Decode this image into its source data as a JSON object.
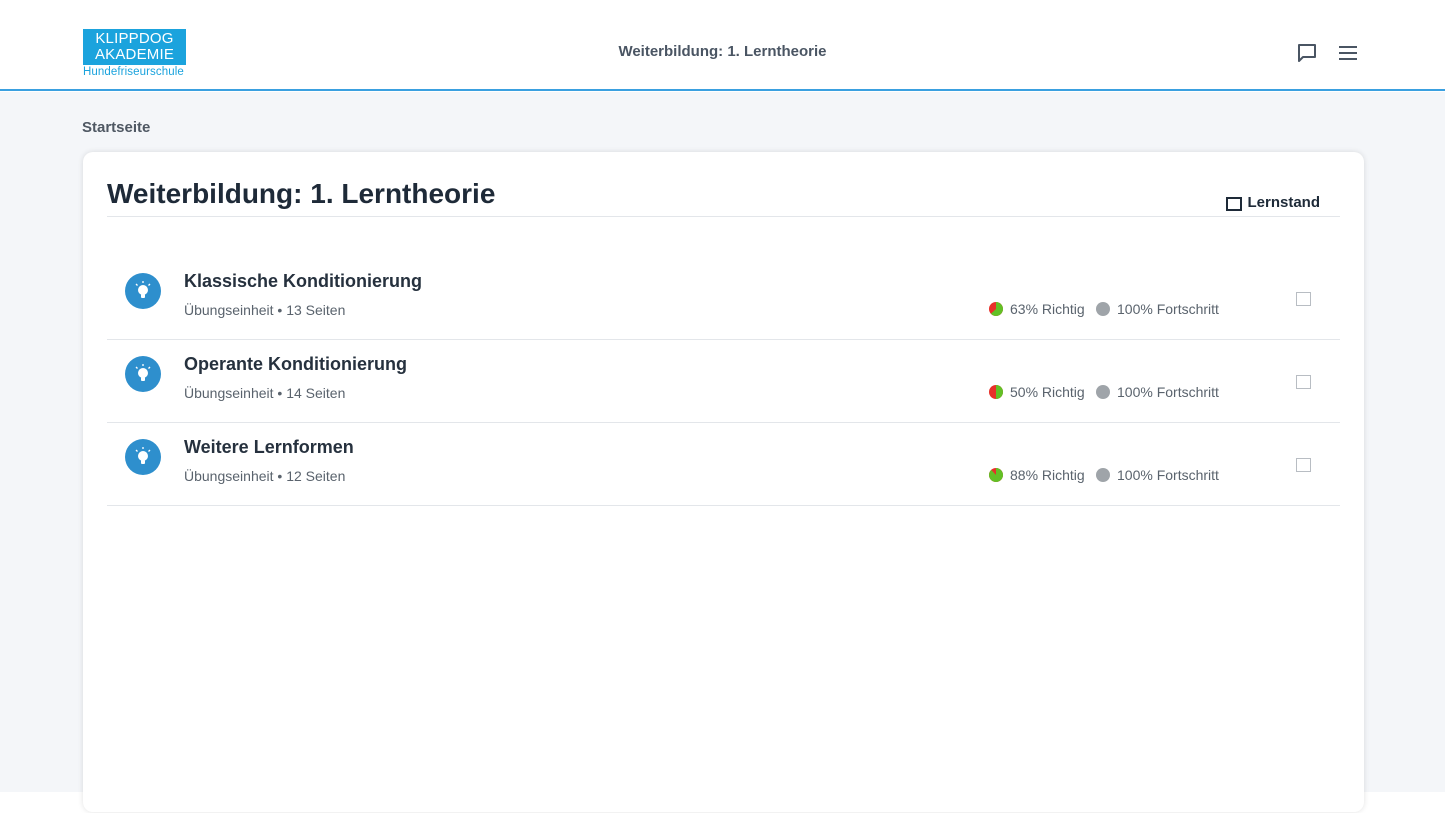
{
  "header": {
    "logo_line1": "KLIPPDOG",
    "logo_line2": "AKADEMIE",
    "logo_sub": "Hundefriseurschule",
    "title": "Weiterbildung: 1. Lerntheorie",
    "icons": [
      "chat-icon",
      "menu-icon"
    ]
  },
  "breadcrumb": "Startseite",
  "card": {
    "title": "Weiterbildung: 1. Lerntheorie",
    "lernstand_label": "Lernstand"
  },
  "units": [
    {
      "title": "Klassische Konditionierung",
      "meta": "Übungseinheit • 13 Seiten",
      "correct_label": "63% Richtig",
      "correct_fraction": 0.63,
      "progress_label": "100% Fortschritt"
    },
    {
      "title": "Operante Konditionierung",
      "meta": "Übungseinheit • 14 Seiten",
      "correct_label": "50% Richtig",
      "correct_fraction": 0.5,
      "progress_label": "100% Fortschritt"
    },
    {
      "title": "Weitere Lernformen",
      "meta": "Übungseinheit • 12 Seiten",
      "correct_label": "88% Richtig",
      "correct_fraction": 0.88,
      "progress_label": "100% Fortschritt"
    }
  ],
  "colors": {
    "accent": "#1ba3dd",
    "icon_bg": "#2e8fcd",
    "correct": "#62c026",
    "wrong": "#e8302a",
    "progress_dot": "#9fa4a9"
  }
}
